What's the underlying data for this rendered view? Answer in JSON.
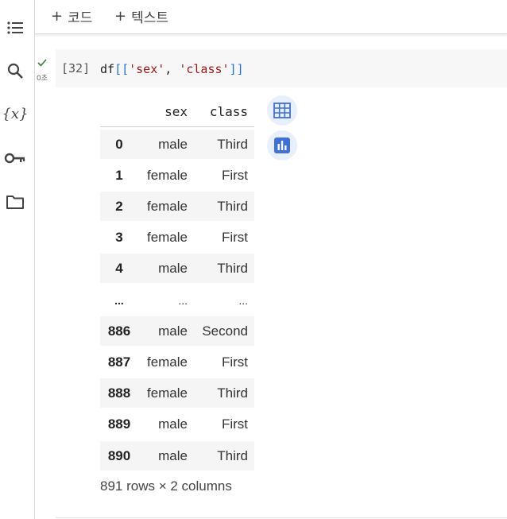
{
  "toolbar": {
    "add_code": "코드",
    "add_text": "텍스트",
    "plus": "+"
  },
  "sidebar": {
    "items": [
      {
        "icon": "toc-icon"
      },
      {
        "icon": "search-icon"
      },
      {
        "icon": "variables-icon",
        "label": "{x}"
      },
      {
        "icon": "key-icon"
      },
      {
        "icon": "folder-icon"
      }
    ]
  },
  "cell": {
    "exec_count": "[32]",
    "run_time": "0초",
    "code": {
      "fn": "df",
      "open": "[[",
      "s1": "'sex'",
      "sep": ", ",
      "s2": "'class'",
      "close": "]]"
    }
  },
  "output": {
    "columns": [
      "sex",
      "class"
    ],
    "rows": [
      {
        "index": "0",
        "sex": "male",
        "class": "Third"
      },
      {
        "index": "1",
        "sex": "female",
        "class": "First"
      },
      {
        "index": "2",
        "sex": "female",
        "class": "Third"
      },
      {
        "index": "3",
        "sex": "female",
        "class": "First"
      },
      {
        "index": "4",
        "sex": "male",
        "class": "Third"
      },
      {
        "index": "...",
        "sex": "...",
        "class": "..."
      },
      {
        "index": "886",
        "sex": "male",
        "class": "Second"
      },
      {
        "index": "887",
        "sex": "female",
        "class": "First"
      },
      {
        "index": "888",
        "sex": "female",
        "class": "Third"
      },
      {
        "index": "889",
        "sex": "male",
        "class": "First"
      },
      {
        "index": "890",
        "sex": "male",
        "class": "Third"
      }
    ],
    "dimensions": "891 rows × 2 columns"
  }
}
